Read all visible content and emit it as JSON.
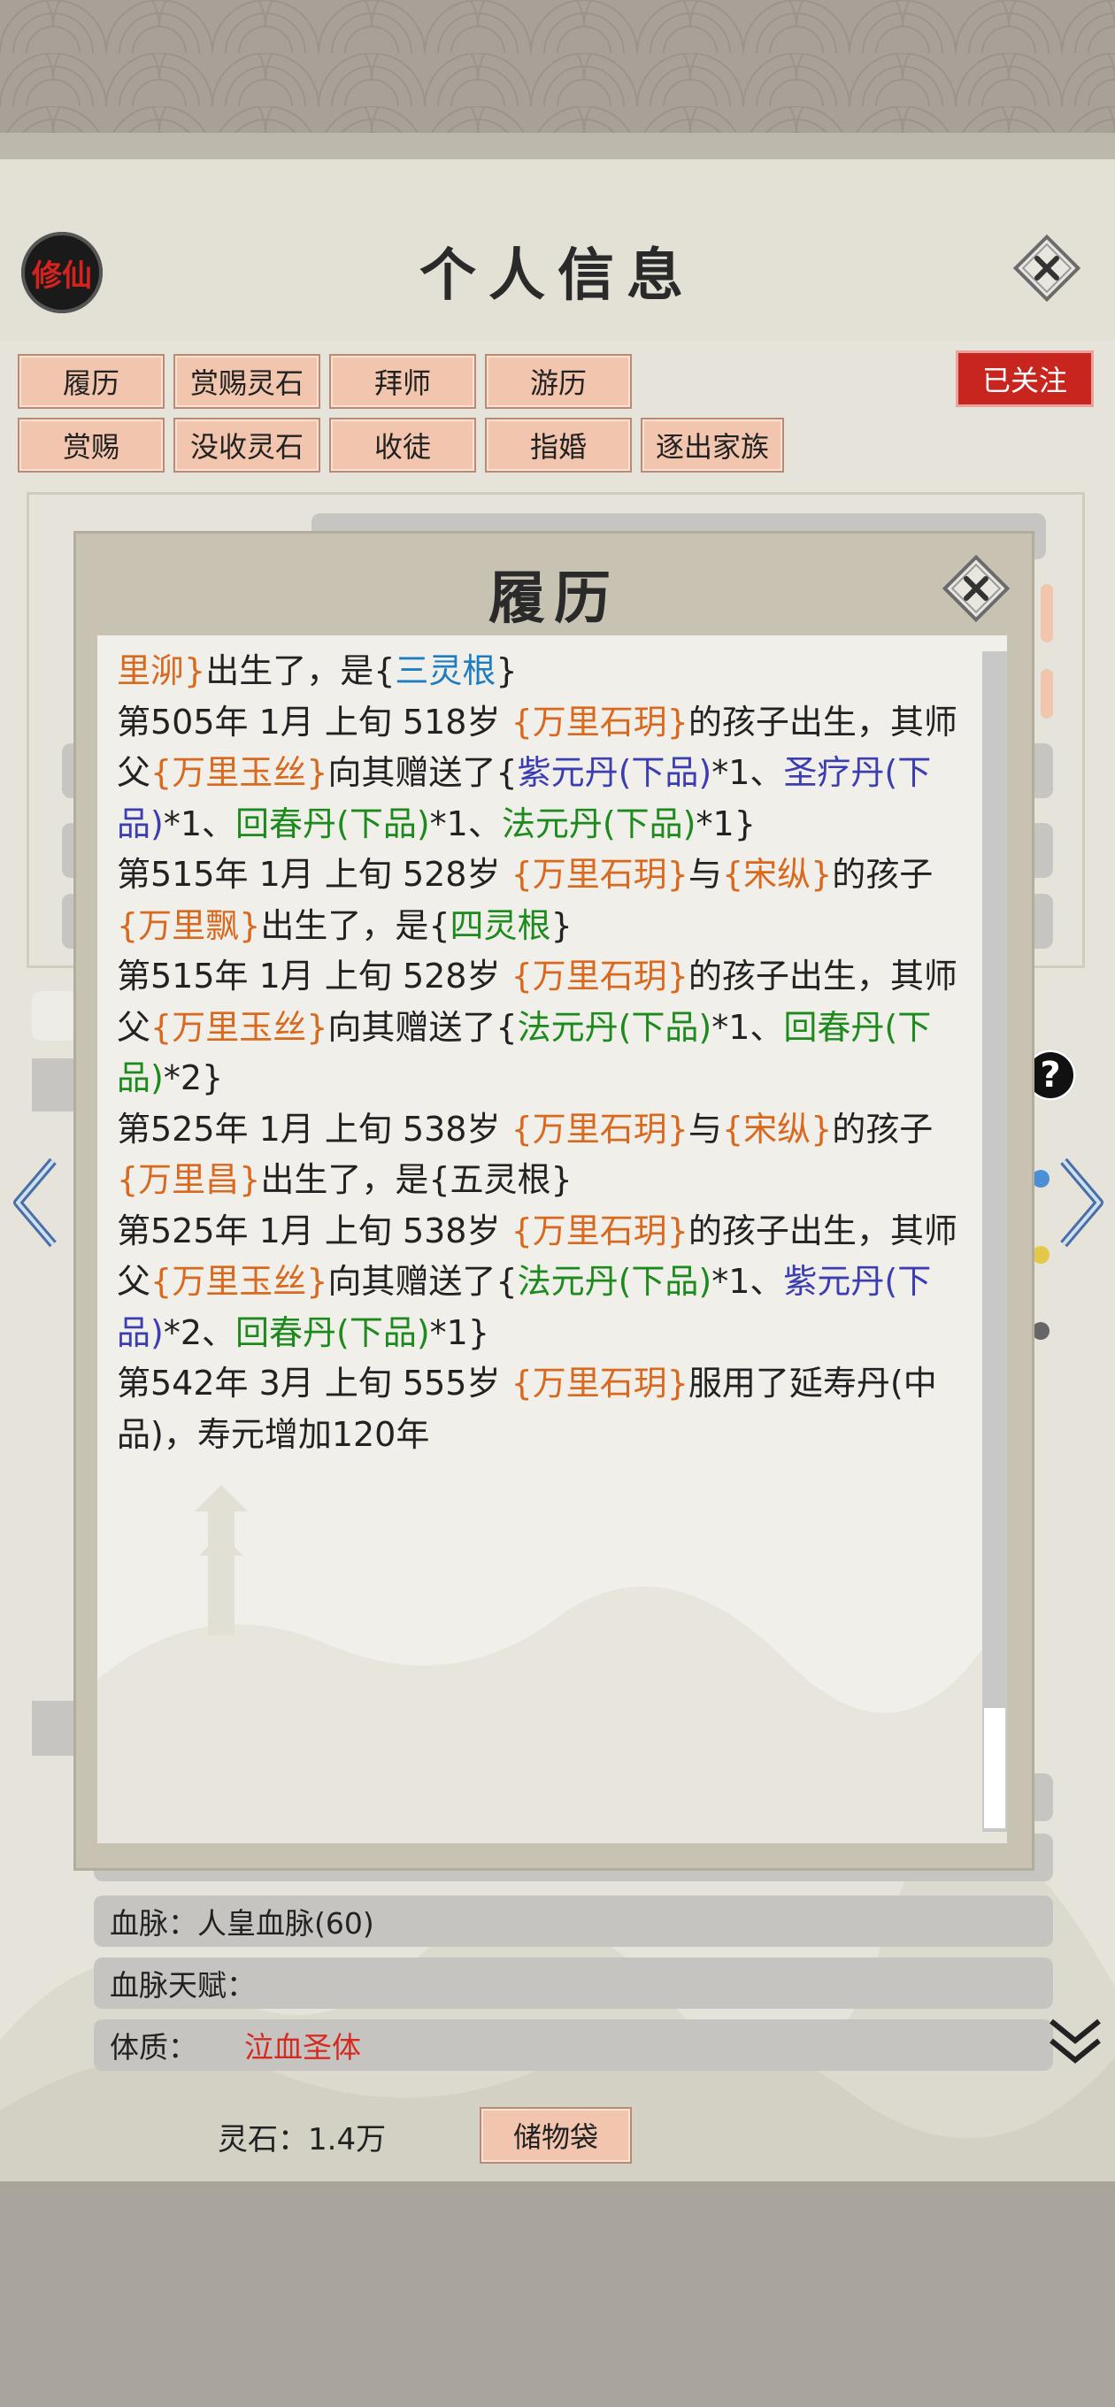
{
  "page_title": "个人信息",
  "logo_text": "修仙",
  "top_buttons": [
    "履历",
    "赏赐灵石",
    "拜师",
    "游历",
    "赏赐",
    "没收灵石",
    "收徒",
    "指婚",
    "逐出家族"
  ],
  "follow_badge": "已关注",
  "modal": {
    "title": "履历",
    "entries": [
      [
        {
          "t": "里泖}",
          "c": "o"
        },
        {
          "t": "出生了，是{",
          "c": "n"
        },
        {
          "t": "三灵根",
          "c": "sb"
        },
        {
          "t": "}",
          "c": "n"
        }
      ],
      [
        {
          "t": "第505年 1月 上旬 518岁 ",
          "c": "n"
        },
        {
          "t": "{万里石玥}",
          "c": "o"
        },
        {
          "t": "的孩子出生，其师父",
          "c": "n"
        },
        {
          "t": "{万里玉丝}",
          "c": "o"
        },
        {
          "t": "向其赠送了{",
          "c": "n"
        },
        {
          "t": "紫元丹(下品)",
          "c": "b"
        },
        {
          "t": "*1、",
          "c": "n"
        },
        {
          "t": "圣疗丹(下品)",
          "c": "b"
        },
        {
          "t": "*1、",
          "c": "n"
        },
        {
          "t": "回春丹(下品)",
          "c": "g"
        },
        {
          "t": "*1、",
          "c": "n"
        },
        {
          "t": "法元丹(下品)",
          "c": "g"
        },
        {
          "t": "*1}",
          "c": "n"
        }
      ],
      [
        {
          "t": "第515年 1月 上旬 528岁 ",
          "c": "n"
        },
        {
          "t": "{万里石玥}",
          "c": "o"
        },
        {
          "t": "与",
          "c": "n"
        },
        {
          "t": "{宋纵}",
          "c": "o"
        },
        {
          "t": "的孩子",
          "c": "n"
        },
        {
          "t": "{万里飘}",
          "c": "o"
        },
        {
          "t": "出生了，是{",
          "c": "n"
        },
        {
          "t": "四灵根",
          "c": "g"
        },
        {
          "t": "}",
          "c": "n"
        }
      ],
      [
        {
          "t": "第515年 1月 上旬 528岁 ",
          "c": "n"
        },
        {
          "t": "{万里石玥}",
          "c": "o"
        },
        {
          "t": "的孩子出生，其师父",
          "c": "n"
        },
        {
          "t": "{万里玉丝}",
          "c": "o"
        },
        {
          "t": "向其赠送了{",
          "c": "n"
        },
        {
          "t": "法元丹(下品)",
          "c": "g"
        },
        {
          "t": "*1、",
          "c": "n"
        },
        {
          "t": "回春丹(下品)",
          "c": "g"
        },
        {
          "t": "*2}",
          "c": "n"
        }
      ],
      [
        {
          "t": "第525年 1月 上旬 538岁 ",
          "c": "n"
        },
        {
          "t": "{万里石玥}",
          "c": "o"
        },
        {
          "t": "与",
          "c": "n"
        },
        {
          "t": "{宋纵}",
          "c": "o"
        },
        {
          "t": "的孩子",
          "c": "n"
        },
        {
          "t": "{万里昌}",
          "c": "o"
        },
        {
          "t": "出生了，是{五灵根}",
          "c": "n"
        }
      ],
      [
        {
          "t": "第525年 1月 上旬 538岁 ",
          "c": "n"
        },
        {
          "t": "{万里石玥}",
          "c": "o"
        },
        {
          "t": "的孩子出生，其师父",
          "c": "n"
        },
        {
          "t": "{万里玉丝}",
          "c": "o"
        },
        {
          "t": "向其赠送了{",
          "c": "n"
        },
        {
          "t": "法元丹(下品)",
          "c": "g"
        },
        {
          "t": "*1、",
          "c": "n"
        },
        {
          "t": "紫元丹(下品)",
          "c": "b"
        },
        {
          "t": "*2、",
          "c": "n"
        },
        {
          "t": "回春丹(下品)",
          "c": "g"
        },
        {
          "t": "*1}",
          "c": "n"
        }
      ],
      [
        {
          "t": "第542年 3月 上旬  555岁  ",
          "c": "n"
        },
        {
          "t": "{万里石玥}",
          "c": "o"
        },
        {
          "t": "服用了延寿丹(中品)，寿元增加120年",
          "c": "n"
        }
      ]
    ]
  },
  "info": {
    "bloodline_label": "血脉：",
    "bloodline_value": "人皇血脉(60)",
    "bloodline_talent_label": "血脉天赋：",
    "physique_label": "体质：",
    "physique_value": "泣血圣体"
  },
  "bottom": {
    "spirit_stone_label": "灵石：",
    "spirit_stone_value": "1.4万",
    "storage_button": "储物袋"
  },
  "colors": {
    "button_bg": "#f2c6ae",
    "follow_badge": "#c8251f",
    "orange_name": "#d9691f",
    "blue_item": "#3b3db0",
    "green_item": "#1c8a1c",
    "physique_red": "#d42a20"
  }
}
